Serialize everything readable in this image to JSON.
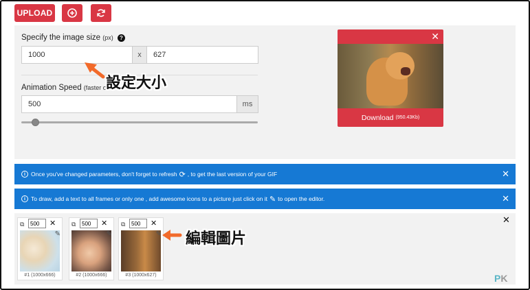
{
  "toolbar": {
    "upload_label": "UPLOAD",
    "add_icon": "plus-circle-icon",
    "refresh_icon": "refresh-icon"
  },
  "settings": {
    "size_label": "Specify the image size",
    "size_unit": "(px)",
    "width_value": "1000",
    "separator": "x",
    "height_value": "627",
    "speed_label": "Animation Speed",
    "speed_hint": "(faster or",
    "speed_value": "500",
    "speed_unit": "ms",
    "speed_slider_fraction": 0.05
  },
  "preview": {
    "download_label": "Download",
    "download_size": "(950.43Kb)"
  },
  "notices": [
    {
      "text_before": "Once you've changed parameters, don't forget to refresh",
      "text_after": ", to get the last version of your GIF"
    },
    {
      "text_before": "To draw, add a text to all frames or only one , add awesome icons to a picture just click on it",
      "text_after": "to open the editor."
    }
  ],
  "frames": [
    {
      "delay": "500",
      "caption": "#1 (1000x666)"
    },
    {
      "delay": "500",
      "caption": "#2 (1000x666)"
    },
    {
      "delay": "500",
      "caption": "#3 (1000x627)"
    }
  ],
  "annotations": {
    "size_note": "設定大小",
    "edit_note": "編輯圖片"
  },
  "watermark": {
    "p": "P",
    "k": "K"
  },
  "colors": {
    "brand_red": "#d93744",
    "notice_blue": "#1679d4",
    "arrow_orange": "#f26a2a"
  }
}
